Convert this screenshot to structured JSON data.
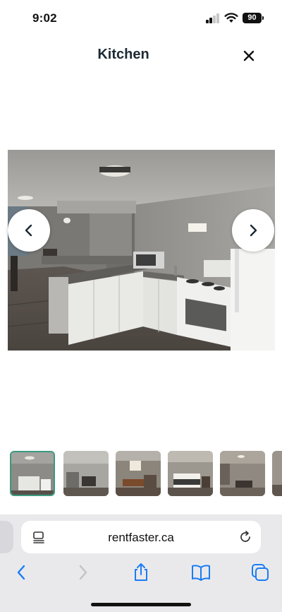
{
  "status_bar": {
    "time": "9:02",
    "battery": "90"
  },
  "header": {
    "title": "Kitchen",
    "close_icon": "close-icon"
  },
  "gallery": {
    "main_photo_subject": "kitchen",
    "thumbnail_count": 6,
    "selected_index": 0,
    "nav_icons": [
      "chevron-left-icon",
      "chevron-right-icon"
    ]
  },
  "browser": {
    "url": "rentfaster.ca",
    "toolbar_icons": [
      "back-icon",
      "forward-icon",
      "share-icon",
      "bookmarks-icon",
      "tabs-icon"
    ],
    "accent_color": "#1a7cf5"
  },
  "colors": {
    "title": "#1d2a33",
    "selected_thumb_border": "#3a9a7e",
    "browser_bar": "#e9e9ec"
  }
}
